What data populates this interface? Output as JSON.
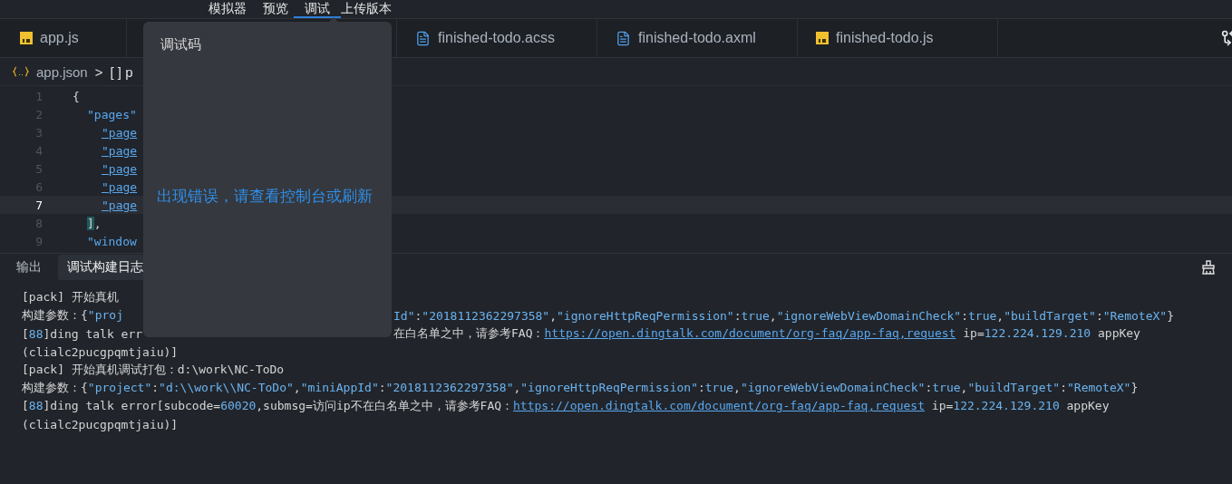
{
  "toolbar": [
    {
      "label": "模拟器",
      "selected": false
    },
    {
      "label": "预览",
      "selected": false
    },
    {
      "label": "调试",
      "selected": true
    },
    {
      "label": "上传版本",
      "selected": false
    }
  ],
  "editor_tabs": [
    {
      "label": "app.js",
      "kind": "js"
    },
    {
      "label": "finished-todo.acss",
      "kind": "file"
    },
    {
      "label": "finished-todo.axml",
      "kind": "file"
    },
    {
      "label": "finished-todo.js",
      "kind": "js"
    }
  ],
  "breadcrumb": {
    "file": "app.json",
    "separator": ">",
    "symbol": "[ ] p"
  },
  "code_lines": [
    {
      "number": "1",
      "current": false,
      "segments": [
        {
          "text": "{",
          "kind": "punct"
        }
      ],
      "children": [
        {
          "number": "2",
          "current": false,
          "segments": [
            {
              "text": "\"pages\"",
              "kind": "key"
            }
          ],
          "children": [
            {
              "number": "3",
              "current": false,
              "segments": [
                {
                  "text": "\"page",
                  "kind": "link"
                }
              ]
            },
            {
              "number": "4",
              "current": false,
              "segments": [
                {
                  "text": "\"page",
                  "kind": "link"
                }
              ]
            },
            {
              "number": "5",
              "current": false,
              "segments": [
                {
                  "text": "\"page",
                  "kind": "link"
                }
              ]
            },
            {
              "number": "6",
              "current": false,
              "segments": [
                {
                  "text": "\"page",
                  "kind": "link"
                }
              ]
            },
            {
              "number": "7",
              "current": true,
              "segments": [
                {
                  "text": "\"page",
                  "kind": "link"
                }
              ]
            }
          ]
        },
        {
          "number": "8",
          "current": false,
          "segments": [
            {
              "text": "]",
              "kind": "match"
            },
            {
              "text": ",",
              "kind": "punct"
            }
          ]
        },
        {
          "number": "9",
          "current": false,
          "segments": [
            {
              "text": "\"window",
              "kind": "key"
            }
          ]
        }
      ]
    }
  ],
  "panel_tabs": [
    {
      "label": "输出",
      "selected": false
    },
    {
      "label": "调试构建日志",
      "selected": true
    }
  ],
  "log": [
    {
      "segments": [
        {
          "text": "[pack] 开始真机",
          "kind": "plain"
        }
      ]
    },
    {
      "segments": [
        {
          "text": "构建参数：{",
          "kind": "plain"
        },
        {
          "text": "\"proj",
          "kind": "value"
        }
      ],
      "resume": [
        {
          "text": "Id\"",
          "kind": "value"
        },
        {
          "text": ":",
          "kind": "plain"
        },
        {
          "text": "\"2018112362297358\"",
          "kind": "value"
        },
        {
          "text": ",",
          "kind": "plain"
        },
        {
          "text": "\"ignoreHttpReqPermission\"",
          "kind": "value"
        },
        {
          "text": ":",
          "kind": "plain"
        },
        {
          "text": "true",
          "kind": "value"
        },
        {
          "text": ",",
          "kind": "plain"
        },
        {
          "text": "\"ignoreWebViewDomainCheck\"",
          "kind": "value"
        },
        {
          "text": ":",
          "kind": "plain"
        },
        {
          "text": "true",
          "kind": "value"
        },
        {
          "text": ",",
          "kind": "plain"
        },
        {
          "text": "\"buildTarget\"",
          "kind": "value"
        },
        {
          "text": ":",
          "kind": "plain"
        },
        {
          "text": "\"RemoteX\"",
          "kind": "value"
        },
        {
          "text": "}",
          "kind": "plain"
        }
      ]
    },
    {
      "segments": [
        {
          "text": "[",
          "kind": "plain"
        },
        {
          "text": "88",
          "kind": "value"
        },
        {
          "text": "]ding talk err",
          "kind": "plain"
        }
      ],
      "resume": [
        {
          "text": "在白名单之中，请参考FAQ：",
          "kind": "plain"
        },
        {
          "text": "https://open.dingtalk.com/document/org-faq/app-faq,request",
          "kind": "link"
        },
        {
          "text": " ip=",
          "kind": "plain"
        },
        {
          "text": "122.224.129.210",
          "kind": "value"
        },
        {
          "text": " appKey",
          "kind": "plain"
        }
      ]
    },
    {
      "segments": [
        {
          "text": "(clialc2pucgpqmtjaiu)]",
          "kind": "plain"
        }
      ]
    },
    {
      "segments": [
        {
          "text": "[pack] 开始真机调试打包：d:\\work\\NC-ToDo",
          "kind": "plain"
        }
      ]
    },
    {
      "segments": [
        {
          "text": "构建参数：{",
          "kind": "plain"
        },
        {
          "text": "\"project\"",
          "kind": "value"
        },
        {
          "text": ":",
          "kind": "plain"
        },
        {
          "text": "\"d:\\\\work\\\\NC-ToDo\"",
          "kind": "value"
        },
        {
          "text": ",",
          "kind": "plain"
        },
        {
          "text": "\"miniAppId\"",
          "kind": "value"
        },
        {
          "text": ":",
          "kind": "plain"
        },
        {
          "text": "\"2018112362297358\"",
          "kind": "value"
        },
        {
          "text": ",",
          "kind": "plain"
        },
        {
          "text": "\"ignoreHttpReqPermission\"",
          "kind": "value"
        },
        {
          "text": ":",
          "kind": "plain"
        },
        {
          "text": "true",
          "kind": "value"
        },
        {
          "text": ",",
          "kind": "plain"
        },
        {
          "text": "\"ignoreWebViewDomainCheck\"",
          "kind": "value"
        },
        {
          "text": ":",
          "kind": "plain"
        },
        {
          "text": "true",
          "kind": "value"
        },
        {
          "text": ",",
          "kind": "plain"
        },
        {
          "text": "\"buildTarget\"",
          "kind": "value"
        },
        {
          "text": ":",
          "kind": "plain"
        },
        {
          "text": "\"RemoteX\"",
          "kind": "value"
        },
        {
          "text": "}",
          "kind": "plain"
        }
      ]
    },
    {
      "segments": [
        {
          "text": "[",
          "kind": "plain"
        },
        {
          "text": "88",
          "kind": "value"
        },
        {
          "text": "]ding talk error[subcode=",
          "kind": "plain"
        },
        {
          "text": "60020",
          "kind": "value"
        },
        {
          "text": ",submsg=访问ip不在白名单之中，请参考FAQ：",
          "kind": "plain"
        },
        {
          "text": "https://open.dingtalk.com/document/org-faq/app-faq,request",
          "kind": "link"
        },
        {
          "text": " ip=",
          "kind": "plain"
        },
        {
          "text": "122.224.129.210",
          "kind": "value"
        },
        {
          "text": " appKey",
          "kind": "plain"
        }
      ]
    },
    {
      "segments": [
        {
          "text": "(clialc2pucgpqmtjaiu)]",
          "kind": "plain"
        }
      ]
    }
  ],
  "popover": {
    "title": "调试码",
    "message": "出现错误，请查看控制台或刷新"
  }
}
